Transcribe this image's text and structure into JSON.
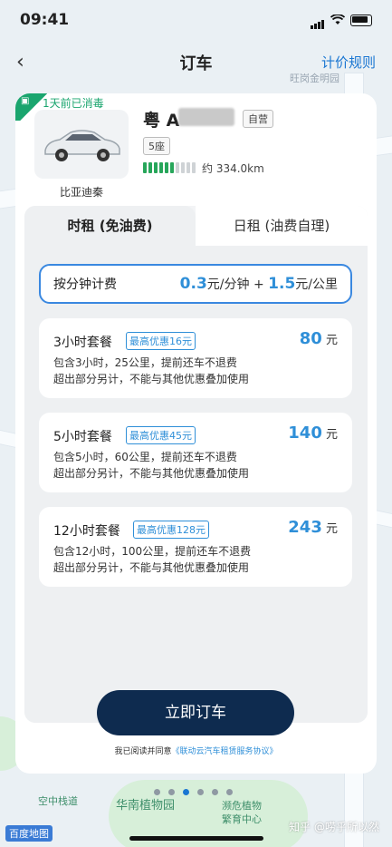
{
  "status": {
    "time": "09:41"
  },
  "nav": {
    "back_glyph": "‹",
    "title": "订车",
    "rule_label": "计价规则"
  },
  "map_labels": {
    "top": "旺岗金明园",
    "bottom1": "空中栈道",
    "bottom2": "华南植物园",
    "bottom3": "濒危植物",
    "bottom4": "繁育中心"
  },
  "car": {
    "cleaned_label": "1天前已消毒",
    "name": "比亚迪秦",
    "plate": "粤 A",
    "ownership": "自营",
    "seats": "5座",
    "range": "约 334.0km",
    "battery_fraction": 0.6
  },
  "tabs": [
    {
      "label": "时租 (免油费)",
      "active": true
    },
    {
      "label": "日租 (油费自理)",
      "active": false
    }
  ],
  "per_minute": {
    "label": "按分钟计费",
    "minute_price": "0.3",
    "minute_unit": "元/分钟 +",
    "km_price": "1.5",
    "km_unit": "元/公里"
  },
  "packages": [
    {
      "name": "3小时套餐",
      "discount": "最高优惠16元",
      "price": "80",
      "unit": "元",
      "desc1": "包含3小时，25公里，提前还车不退费",
      "desc2": "超出部分另计，不能与其他优惠叠加使用"
    },
    {
      "name": "5小时套餐",
      "discount": "最高优惠45元",
      "price": "140",
      "unit": "元",
      "desc1": "包含5小时，60公里，提前还车不退费",
      "desc2": "超出部分另计，不能与其他优惠叠加使用"
    },
    {
      "name": "12小时套餐",
      "discount": "最高优惠128元",
      "price": "243",
      "unit": "元",
      "desc1": "包含12小时，100公里，提前还车不退费",
      "desc2": "超出部分另计，不能与其他优惠叠加使用"
    }
  ],
  "book_label": "立即订车",
  "agreement": {
    "prefix": "我已阅读并同意",
    "link": "《联动云汽车租赁服务协议》"
  },
  "watermark": "知乎 @唠乎所以然",
  "logo": "百度地图"
}
